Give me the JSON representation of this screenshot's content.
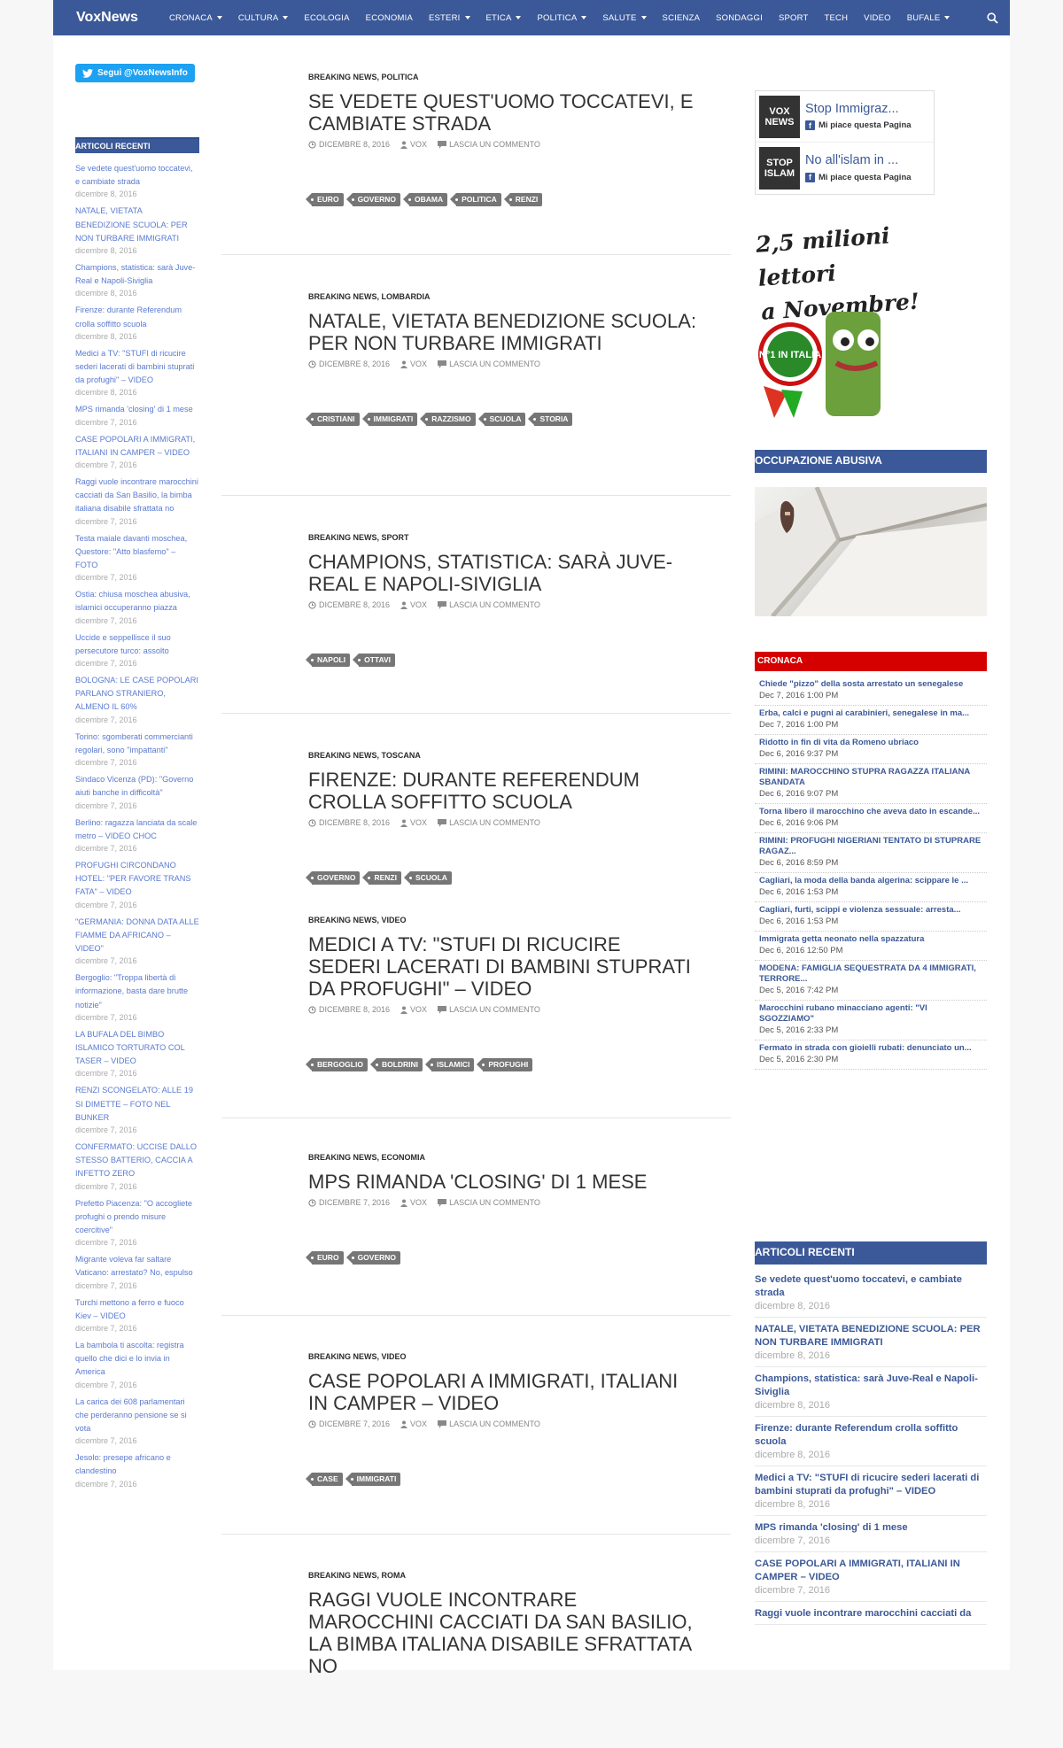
{
  "nav": {
    "brand": "VoxNews",
    "items": [
      {
        "label": "CRONACA",
        "dropdown": true
      },
      {
        "label": "CULTURA",
        "dropdown": true
      },
      {
        "label": "ECOLOGIA",
        "dropdown": false
      },
      {
        "label": "ECONOMIA",
        "dropdown": false
      },
      {
        "label": "ESTERI",
        "dropdown": true
      },
      {
        "label": "ETICA",
        "dropdown": true
      },
      {
        "label": "POLITICA",
        "dropdown": true
      },
      {
        "label": "SALUTE",
        "dropdown": true
      },
      {
        "label": "SCIENZA",
        "dropdown": false
      },
      {
        "label": "SONDAGGI",
        "dropdown": false
      },
      {
        "label": "SPORT",
        "dropdown": false
      },
      {
        "label": "TECH",
        "dropdown": false
      },
      {
        "label": "VIDEO",
        "dropdown": false
      },
      {
        "label": "BUFALE",
        "dropdown": true
      }
    ]
  },
  "left": {
    "twitter_label": "Segui @VoxNewsInfo",
    "recent_title": "ARTICOLI RECENTI",
    "items": [
      {
        "title": "Se vedete quest'uomo toccatevi, e cambiate strada",
        "date": "dicembre 8, 2016"
      },
      {
        "title": "NATALE, VIETATA BENEDIZIONE SCUOLA: PER NON TURBARE IMMIGRATI",
        "date": "dicembre 8, 2016"
      },
      {
        "title": "Champions, statistica: sarà Juve-Real e Napoli-Siviglia",
        "date": "dicembre 8, 2016"
      },
      {
        "title": "Firenze: durante Referendum crolla soffitto scuola",
        "date": "dicembre 8, 2016"
      },
      {
        "title": "Medici a TV: \"STUFI di ricucire sederi lacerati di bambini stuprati da profughi\" – VIDEO",
        "date": "dicembre 8, 2016"
      },
      {
        "title": "MPS rimanda 'closing' di 1 mese",
        "date": "dicembre 7, 2016"
      },
      {
        "title": "CASE POPOLARI A IMMIGRATI, ITALIANI IN CAMPER – VIDEO",
        "date": "dicembre 7, 2016"
      },
      {
        "title": "Raggi vuole incontrare marocchini cacciati da San Basilio, la bimba italiana disabile sfrattata no",
        "date": "dicembre 7, 2016"
      },
      {
        "title": "Testa maiale davanti moschea, Questore: \"Atto blasfemo\" – FOTO",
        "date": "dicembre 7, 2016"
      },
      {
        "title": "Ostia: chiusa moschea abusiva, islamici occuperanno piazza",
        "date": "dicembre 7, 2016"
      },
      {
        "title": "Uccide e seppellisce il suo persecutore turco: assolto",
        "date": "dicembre 7, 2016"
      },
      {
        "title": "BOLOGNA: LE CASE POPOLARI PARLANO STRANIERO, ALMENO IL 60%",
        "date": "dicembre 7, 2016"
      },
      {
        "title": "Torino: sgomberati commercianti regolari, sono \"impattanti\"",
        "date": "dicembre 7, 2016"
      },
      {
        "title": "Sindaco Vicenza (PD): \"Governo aiuti banche in difficoltà\"",
        "date": "dicembre 7, 2016"
      },
      {
        "title": "Berlino: ragazza lanciata da scale metro – VIDEO CHOC",
        "date": "dicembre 7, 2016"
      },
      {
        "title": "PROFUGHI CIRCONDANO HOTEL: \"PER FAVORE TRANS FATA\" – VIDEO",
        "date": "dicembre 7, 2016"
      },
      {
        "title": "\"GERMANIA: DONNA DATA ALLE FIAMME DA AFRICANO – VIDEO\"",
        "date": "dicembre 7, 2016"
      },
      {
        "title": "Bergoglio: \"Troppa libertà di informazione, basta dare brutte notizie\"",
        "date": "dicembre 7, 2016"
      },
      {
        "title": "LA BUFALA DEL BIMBO ISLAMICO TORTURATO COL TASER – VIDEO",
        "date": "dicembre 7, 2016"
      },
      {
        "title": "RENZI SCONGELATO: ALLE 19 SI DIMETTE – FOTO NEL BUNKER",
        "date": "dicembre 7, 2016"
      },
      {
        "title": "CONFERMATO: UCCISE DALLO STESSO BATTERIO, CACCIA A INFETTO ZERO",
        "date": "dicembre 7, 2016"
      },
      {
        "title": "Prefetto Piacenza: \"O accogliete profughi o prendo misure coercitive\"",
        "date": "dicembre 7, 2016"
      },
      {
        "title": "Migrante voleva far saltare Vaticano: arrestato? No, espulso",
        "date": "dicembre 7, 2016"
      },
      {
        "title": "Turchi mettono a ferro e fuoco Kiev – VIDEO",
        "date": "dicembre 7, 2016"
      },
      {
        "title": "La bambola ti ascolta: registra quello che dici e lo invia in America",
        "date": "dicembre 7, 2016"
      },
      {
        "title": "La carica dei 608 parlamentari che perderanno pensione se si vota",
        "date": "dicembre 7, 2016"
      },
      {
        "title": "Jesolo: presepe africano e clandestino",
        "date": "dicembre 7, 2016"
      }
    ]
  },
  "posts": [
    {
      "cats": "BREAKING NEWS, POLITICA",
      "title": "SE VEDETE QUEST'UOMO TOCCATEVI, E CAMBIATE STRADA",
      "date": "DICEMBRE 8, 2016",
      "author": "VOX",
      "comments": "LASCIA UN COMMENTO",
      "tags": [
        "EURO",
        "GOVERNO",
        "OBAMA",
        "POLITICA",
        "RENZI"
      ]
    },
    {
      "cats": "BREAKING NEWS, LOMBARDIA",
      "title": "NATALE, VIETATA BENEDIZIONE SCUOLA: PER NON TURBARE IMMIGRATI",
      "date": "DICEMBRE 8, 2016",
      "author": "VOX",
      "comments": "LASCIA UN COMMENTO",
      "tags": [
        "CRISTIANI",
        "IMMIGRATI",
        "RAZZISMO",
        "SCUOLA",
        "STORIA"
      ]
    },
    {
      "cats": "BREAKING NEWS, SPORT",
      "title": "CHAMPIONS, STATISTICA: SARÀ JUVE-REAL E NAPOLI-SIVIGLIA",
      "date": "DICEMBRE 8, 2016",
      "author": "VOX",
      "comments": "LASCIA UN COMMENTO",
      "tags": [
        "NAPOLI",
        "OTTAVI"
      ]
    },
    {
      "cats": "BREAKING NEWS, TOSCANA",
      "title": "FIRENZE: DURANTE REFERENDUM CROLLA SOFFITTO SCUOLA",
      "date": "DICEMBRE 8, 2016",
      "author": "VOX",
      "comments": "LASCIA UN COMMENTO",
      "tags": [
        "GOVERNO",
        "RENZI",
        "SCUOLA"
      ]
    },
    {
      "cats": "BREAKING NEWS, VIDEO",
      "title": "MEDICI A TV: \"STUFI DI RICUCIRE SEDERI LACERATI DI BAMBINI STUPRATI DA PROFUGHI\" – VIDEO",
      "date": "DICEMBRE 8, 2016",
      "author": "VOX",
      "comments": "LASCIA UN COMMENTO",
      "tags": [
        "BERGOGLIO",
        "BOLDRINI",
        "ISLAMICI",
        "PROFUGHI"
      ]
    },
    {
      "cats": "BREAKING NEWS, ECONOMIA",
      "title": "MPS RIMANDA 'CLOSING' DI 1 MESE",
      "date": "DICEMBRE 7, 2016",
      "author": "VOX",
      "comments": "LASCIA UN COMMENTO",
      "tags": [
        "EURO",
        "GOVERNO"
      ]
    },
    {
      "cats": "BREAKING NEWS, VIDEO",
      "title": "CASE POPOLARI A IMMIGRATI, ITALIANI IN CAMPER – VIDEO",
      "date": "DICEMBRE 7, 2016",
      "author": "VOX",
      "comments": "LASCIA UN COMMENTO",
      "tags": [
        "CASE",
        "IMMIGRATI"
      ]
    },
    {
      "cats": "BREAKING NEWS, ROMA",
      "title": "RAGGI VUOLE INCONTRARE MAROCCHINI CACCIATI DA SAN BASILIO, LA BIMBA ITALIANA DISABILE SFRATTATA NO",
      "date": "",
      "author": "",
      "comments": "",
      "tags": []
    }
  ],
  "right": {
    "fb_pages": [
      {
        "logo": "VOX NEWS",
        "name": "Stop Immigraz...",
        "like": "Mi piace questa Pagina"
      },
      {
        "logo": "STOP ISLAM",
        "name": "No all'islam in ...",
        "like": "Mi piace questa Pagina"
      }
    ],
    "promo_line1": "2,5 milioni lettori",
    "promo_line2": "a Novembre!",
    "promo_badge": "N°1 IN ITALIA",
    "occupazione_title": "OCCUPAZIONE ABUSIVA",
    "cronaca_title": "CRONACA",
    "cronaca_items": [
      {
        "title": "Chiede \"pizzo\" della sosta arrestato un senegalese",
        "date": "Dec 7, 2016 1:00 PM"
      },
      {
        "title": "Erba, calci e pugni ai carabinieri, senegalese in ma...",
        "date": "Dec 7, 2016 1:00 PM"
      },
      {
        "title": "Ridotto in fin di vita da Romeno ubriaco",
        "date": "Dec 6, 2016 9:37 PM"
      },
      {
        "title": "RIMINI: MAROCCHINO STUPRA RAGAZZA ITALIANA SBANDATA",
        "date": "Dec 6, 2016 9:07 PM"
      },
      {
        "title": "Torna libero il marocchino che aveva dato in escande...",
        "date": "Dec 6, 2016 9:06 PM"
      },
      {
        "title": "RIMINI: PROFUGHI NIGERIANI TENTATO DI STUPRARE RAGAZ...",
        "date": "Dec 6, 2016 8:59 PM"
      },
      {
        "title": "Cagliari, la moda della banda algerina: scippare le ...",
        "date": "Dec 6, 2016 1:53 PM"
      },
      {
        "title": "Cagliari, furti, scippi e violenza sessuale: arresta...",
        "date": "Dec 6, 2016 1:53 PM"
      },
      {
        "title": "Immigrata getta neonato nella spazzatura",
        "date": "Dec 6, 2016 12:50 PM"
      },
      {
        "title": "MODENA: FAMIGLIA SEQUESTRATA DA 4 IMMIGRATI, TERRORE...",
        "date": "Dec 5, 2016 7:42 PM"
      },
      {
        "title": "Marocchini rubano minacciano agenti: \"VI SGOZZIAMO\"",
        "date": "Dec 5, 2016 2:33 PM"
      },
      {
        "title": "Fermato in strada con gioielli rubati: denunciato un...",
        "date": "Dec 5, 2016 2:30 PM"
      }
    ],
    "recent_title": "ARTICOLI RECENTI",
    "recent_items": [
      {
        "title": "Se vedete quest'uomo toccatevi, e cambiate strada",
        "date": "dicembre 8, 2016"
      },
      {
        "title": "NATALE, VIETATA BENEDIZIONE SCUOLA: PER NON TURBARE IMMIGRATI",
        "date": "dicembre 8, 2016"
      },
      {
        "title": "Champions, statistica: sarà Juve-Real e Napoli-Siviglia",
        "date": "dicembre 8, 2016"
      },
      {
        "title": "Firenze: durante Referendum crolla soffitto scuola",
        "date": "dicembre 8, 2016"
      },
      {
        "title": "Medici a TV: \"STUFI di ricucire sederi lacerati di bambini stuprati da profughi\" – VIDEO",
        "date": "dicembre 8, 2016"
      },
      {
        "title": "MPS rimanda 'closing' di 1 mese",
        "date": "dicembre 7, 2016"
      },
      {
        "title": "CASE POPOLARI A IMMIGRATI, ITALIANI IN CAMPER – VIDEO",
        "date": "dicembre 7, 2016"
      },
      {
        "title": "Raggi vuole incontrare marocchini cacciati da",
        "date": ""
      }
    ]
  }
}
